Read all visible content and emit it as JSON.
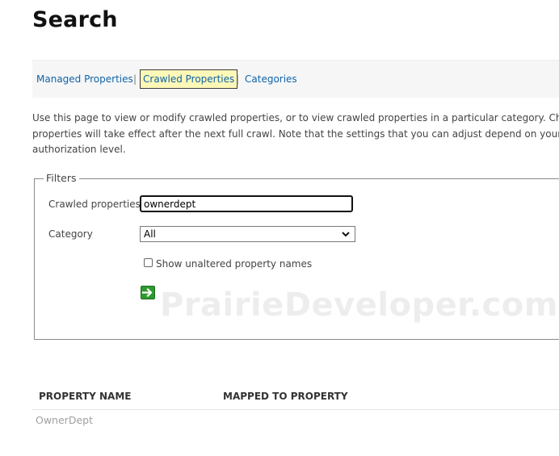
{
  "page": {
    "title": "Search"
  },
  "tabs": [
    {
      "label": "Managed Properties",
      "active": false
    },
    {
      "label": "Crawled Properties",
      "active": true
    },
    {
      "label": "Categories",
      "active": false
    }
  ],
  "separator": "|",
  "description": {
    "line1": "Use this page to view or modify crawled properties, or to view crawled properties in a particular category. Changes",
    "line2": "properties will take effect after the next full crawl. Note that the settings that you can adjust depend on your curren",
    "line3": "authorization level."
  },
  "filters": {
    "legend": "Filters",
    "crawled_label": "Crawled properties",
    "crawled_value": "ownerdept",
    "category_label": "Category",
    "category_value": "All",
    "checkbox_label": "Show unaltered property names",
    "checkbox_checked": false
  },
  "watermark": "PrairieDeveloper.com",
  "results": {
    "columns": [
      "PROPERTY NAME",
      "MAPPED TO PROPERTY"
    ],
    "rows": [
      {
        "property_name": "OwnerDept",
        "mapped_to": ""
      }
    ]
  },
  "colors": {
    "link": "#0f63a8",
    "active_tab_bg": "#fdf8b8",
    "go_button": "#2e9a2e"
  },
  "icons": {
    "go_button": "go-arrow-icon",
    "select": "chevron-down-icon"
  }
}
